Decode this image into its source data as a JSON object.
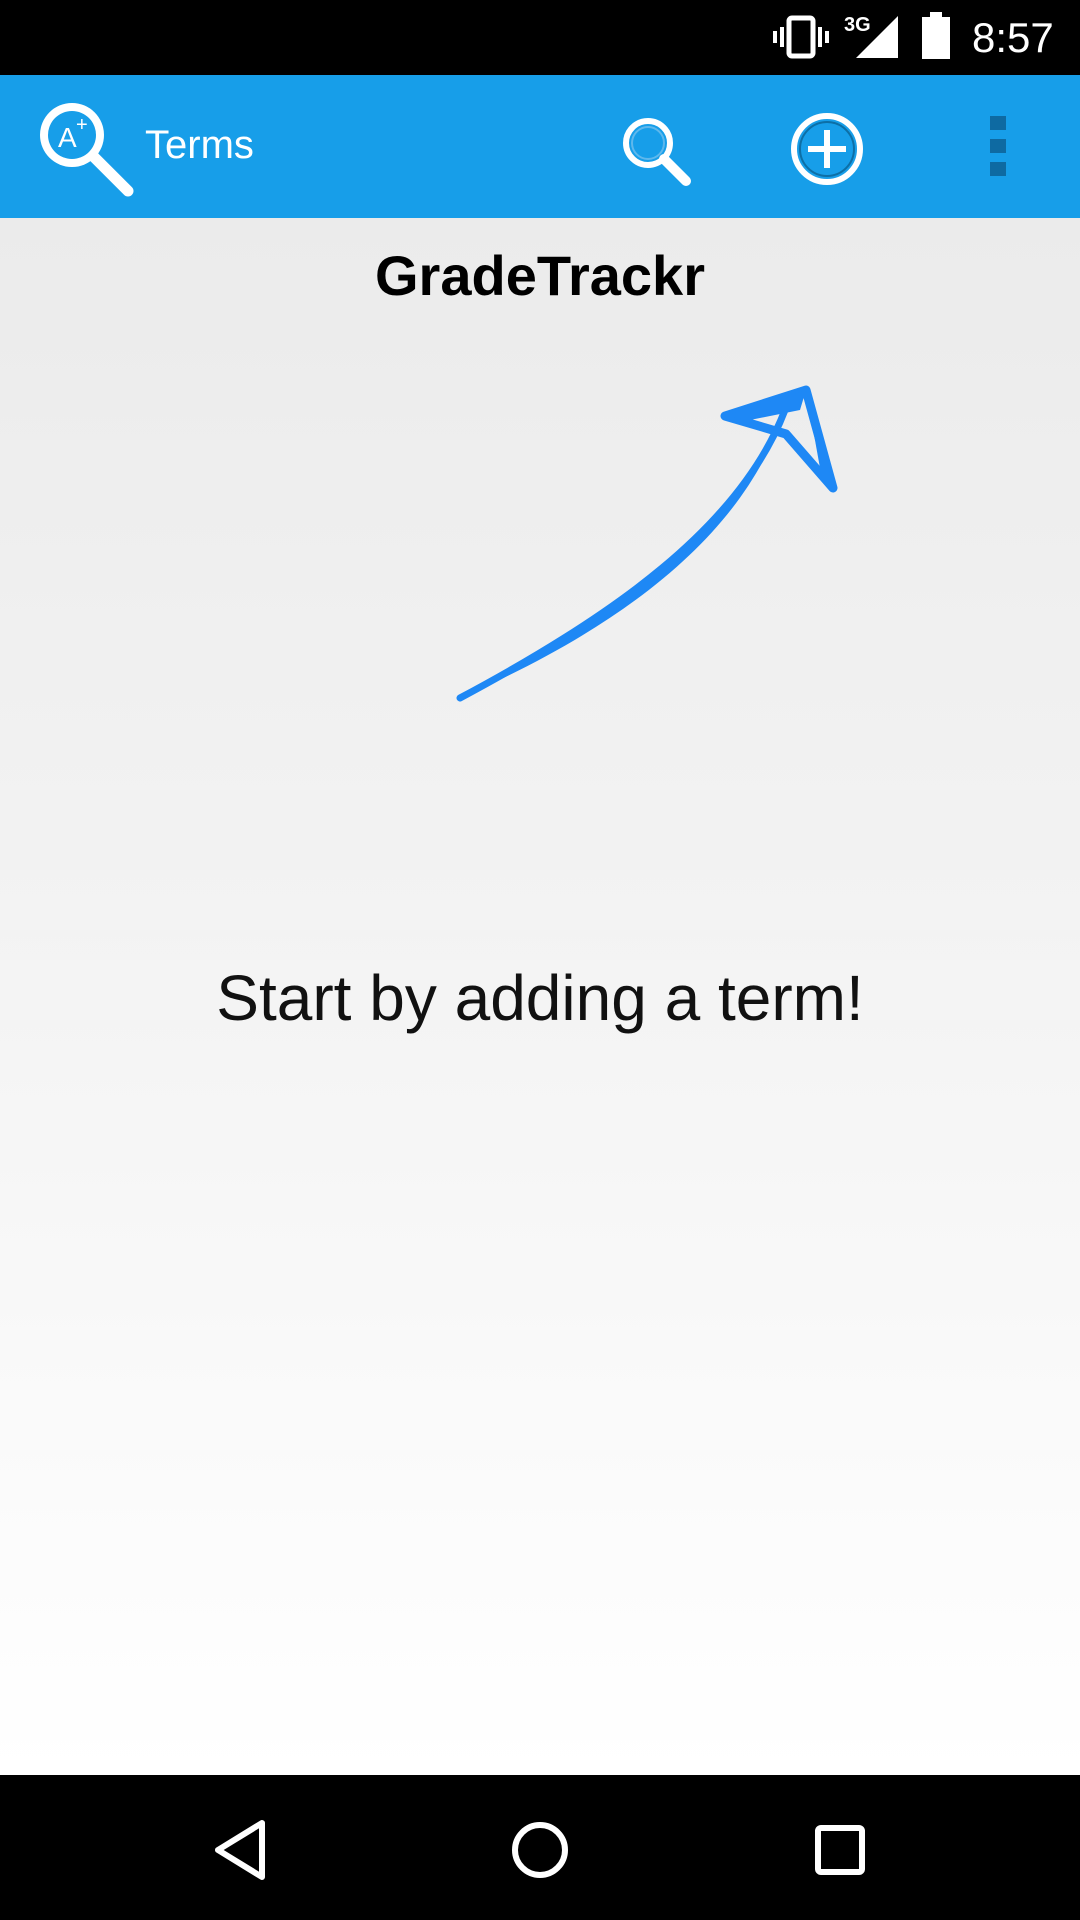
{
  "status_bar": {
    "network_type": "3G",
    "time": "8:57",
    "icons": [
      "vibrate-icon",
      "signal-icon",
      "battery-icon"
    ]
  },
  "app_bar": {
    "logo_icon": "magnifier-aplus-logo-icon",
    "title": "Terms",
    "actions": [
      "search-icon",
      "add-circle-icon",
      "overflow-menu-icon"
    ],
    "color": "#179ee9"
  },
  "content": {
    "brand_title": "GradeTrackr",
    "arrow_icon": "curved-arrow-icon",
    "arrow_color": "#1e88f5",
    "empty_message": "Start by adding a term!"
  },
  "nav_bar": {
    "icons": [
      "back-icon",
      "home-icon",
      "recents-icon"
    ]
  }
}
